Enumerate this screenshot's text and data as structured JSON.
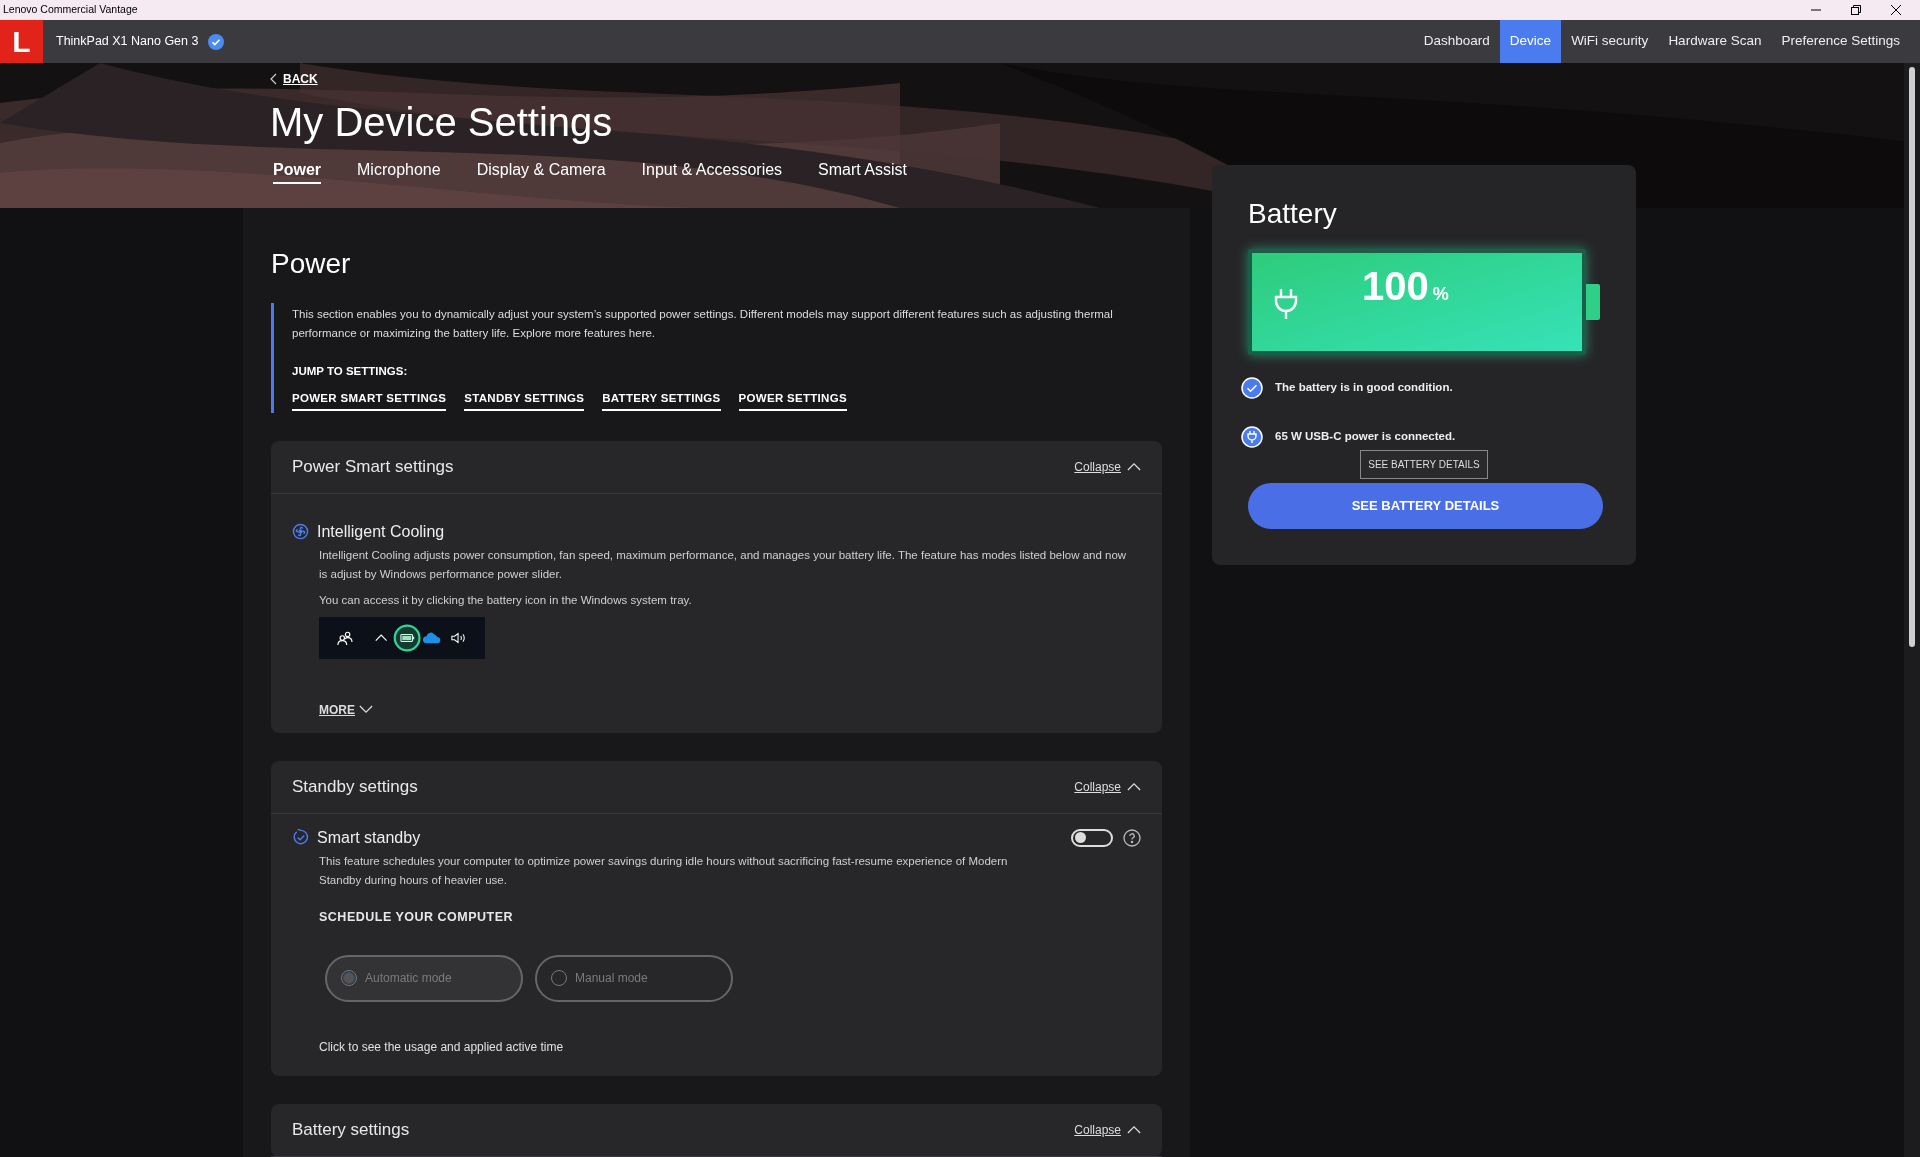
{
  "window": {
    "title": "Lenovo Commercial Vantage"
  },
  "app_bar": {
    "device_name": "ThinkPad X1 Nano Gen 3",
    "logo": "L",
    "nav": [
      {
        "label": "Dashboard",
        "selected": false
      },
      {
        "label": "Device",
        "selected": true
      },
      {
        "label": "WiFi security",
        "selected": false
      },
      {
        "label": "Hardware Scan",
        "selected": false
      },
      {
        "label": "Preference Settings",
        "selected": false
      }
    ]
  },
  "header": {
    "back": "BACK",
    "title": "My Device Settings",
    "tabs": [
      {
        "label": "Power",
        "selected": true
      },
      {
        "label": "Microphone",
        "selected": false
      },
      {
        "label": "Display & Camera",
        "selected": false
      },
      {
        "label": "Input & Accessories",
        "selected": false
      },
      {
        "label": "Smart Assist",
        "selected": false
      }
    ]
  },
  "power": {
    "title": "Power",
    "intro": "This section enables you to dynamically adjust your system’s supported power settings. Different models may support different features such as adjusting thermal performance or maximizing the battery life. Explore more features here.",
    "jump_label": "JUMP TO SETTINGS:",
    "jump_links": [
      "POWER SMART SETTINGS",
      "STANDBY SETTINGS",
      "BATTERY SETTINGS",
      "POWER SETTINGS"
    ]
  },
  "sections": [
    {
      "kind": "cooling",
      "title": "Power Smart settings",
      "collapse": "Collapse",
      "expanded": true,
      "feature": {
        "title": "Intelligent Cooling",
        "description": "Intelligent Cooling adjusts power consumption, fan speed, maximum performance, and manages your battery life. The feature has modes listed below and now is adjust by Windows performance power slider.",
        "hint": "You can access it by clicking the battery icon in the Windows system tray.",
        "more": "MORE"
      }
    },
    {
      "kind": "standby",
      "title": "Standby settings",
      "collapse": "Collapse",
      "expanded": true,
      "feature": {
        "title": "Smart standby",
        "on": false,
        "description": "This feature schedules your computer to optimize power savings during idle hours without sacrificing fast-resume experience of Modern Standby during hours of heavier use.",
        "schedule_label": "SCHEDULE YOUR COMPUTER",
        "modes": [
          {
            "label": "Automatic mode",
            "selected": true,
            "disabled": true
          },
          {
            "label": "Manual mode",
            "selected": false,
            "disabled": true
          }
        ],
        "usage_link": "Click to see the usage and applied active time"
      }
    },
    {
      "kind": "battery",
      "title": "Battery settings",
      "collapse": "Collapse",
      "expanded": true
    }
  ],
  "battery": {
    "title": "Battery",
    "percent": "100",
    "unit": "%",
    "level": 1.0,
    "status": [
      {
        "kind": "check",
        "text": "The battery is in good condition."
      },
      {
        "kind": "plug",
        "text": "65 W USB-C power is connected."
      }
    ],
    "tooltip": "SEE BATTERY DETAILS",
    "button": "SEE BATTERY DETAILS"
  }
}
